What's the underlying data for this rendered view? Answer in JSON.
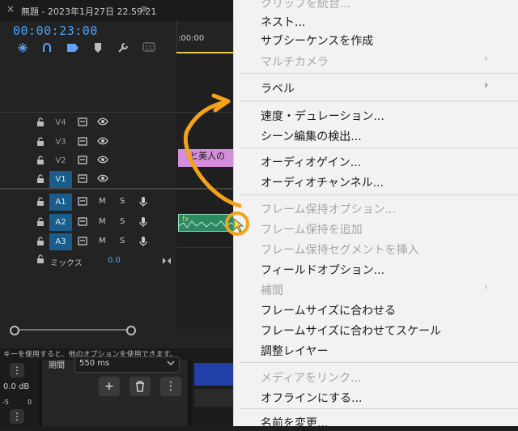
{
  "timeline": {
    "close_glyph": "×",
    "title": "無題 - 2023年1月27日 22.59.21",
    "menu_glyph": "≡",
    "timecode": "00:00:23:00",
    "ruler_label": ":00:00",
    "tools": [
      "snap-icon",
      "link-icon",
      "marker-add-icon",
      "marker-icon",
      "wrench-icon",
      "cc-icon"
    ],
    "tracks": [
      {
        "name": "V4",
        "type": "video",
        "active": false
      },
      {
        "name": "V3",
        "type": "video",
        "active": false
      },
      {
        "name": "V2",
        "type": "video",
        "active": false
      },
      {
        "name": "V1",
        "type": "video",
        "active": true
      },
      {
        "name": "A1",
        "type": "audio",
        "active": true
      },
      {
        "name": "A2",
        "type": "audio",
        "active": true
      },
      {
        "name": "A3",
        "type": "audio",
        "active": true
      }
    ],
    "mute_label": "M",
    "solo_label": "S",
    "mix_label": "ミックス",
    "mix_value": "0.0",
    "clip_v2_text": "と美人の",
    "fx_label": "fx"
  },
  "status": {
    "text": "キーを使用すると、他のオプションを使用できます。"
  },
  "lower": {
    "db_label": "0.0 dB",
    "period_label": "期間",
    "ms_value": "550 ms",
    "scale_left": "-5",
    "scale_right": "0",
    "add_glyph": "+",
    "trash_glyph": "🗑",
    "more_glyph": "⋮"
  },
  "menu": {
    "items": [
      {
        "label": "クリップを統合...",
        "disabled": true
      },
      {
        "label": "ネスト...",
        "disabled": false
      },
      {
        "label": "サブシーケンスを作成",
        "disabled": false
      },
      {
        "label": "マルチカメラ",
        "disabled": true,
        "submenu": true
      },
      {
        "label": "ラベル",
        "disabled": false,
        "submenu": true
      },
      {
        "label": "速度・デュレーション...",
        "disabled": false
      },
      {
        "label": "シーン編集の検出...",
        "disabled": false
      },
      {
        "label": "オーディオゲイン...",
        "disabled": false
      },
      {
        "label": "オーディオチャンネル...",
        "disabled": false
      },
      {
        "label": "フレーム保持オプション...",
        "disabled": true
      },
      {
        "label": "フレーム保持を追加",
        "disabled": true
      },
      {
        "label": "フレーム保持セグメントを挿入",
        "disabled": true
      },
      {
        "label": "フィールドオプション...",
        "disabled": false
      },
      {
        "label": "補間",
        "disabled": true,
        "submenu": true
      },
      {
        "label": "フレームサイズに合わせる",
        "disabled": false
      },
      {
        "label": "フレームサイズに合わせてスケール",
        "disabled": false
      },
      {
        "label": "調整レイヤー",
        "disabled": false
      },
      {
        "label": "メディアをリンク...",
        "disabled": true
      },
      {
        "label": "オフラインにする...",
        "disabled": false
      },
      {
        "label": "名前を変更...",
        "disabled": false
      }
    ],
    "submenu_glyph": "›"
  },
  "colors": {
    "accent_blue": "#4aa3ff",
    "track_active": "#1a5d8b",
    "annotation_orange": "#f5a21b",
    "clip_pink": "#d28ed8",
    "clip_green": "#2b8a61"
  }
}
